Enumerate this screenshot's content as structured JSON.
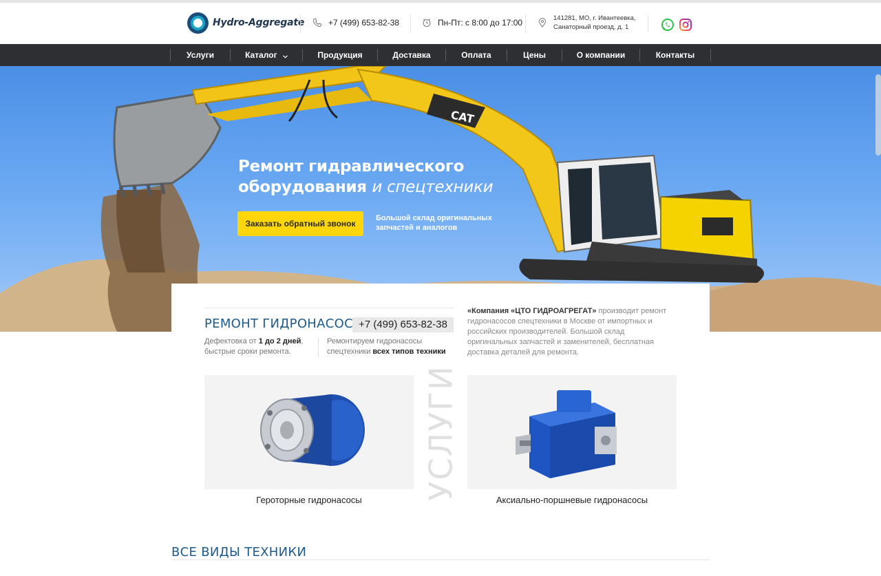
{
  "header": {
    "logo_text": "Hydro-Aggregate",
    "phone": "+7 (499) 653-82-38",
    "hours": "Пн-Пт: с 8:00 до 17:00",
    "address_line1": "141281, МО, г. Ивантеевка,",
    "address_line2": "Санаторный проезд, д. 1"
  },
  "nav": {
    "items": [
      "Услуги",
      "Каталог",
      "Продукция",
      "Доставка",
      "Оплата",
      "Цены",
      "О компании",
      "Контакты"
    ]
  },
  "hero": {
    "title_line1": "Ремонт гидравлического",
    "title_line2_bold": "оборудования",
    "title_line2_italic": "и спецтехники",
    "cta_label": "Заказать обратный звонок",
    "note": "Большой склад оригинальных запчастей и аналогов"
  },
  "repair": {
    "title": "РЕМОНТ ГИДРОНАСОСОВ",
    "phone": "+7 (499) 653-82-38",
    "left_text_1": "Дефектовка от",
    "left_text_bold": "1 до 2 дней",
    "left_text_2": ",",
    "left_text_3": "быстрые сроки ремонта.",
    "right_text_1": "Ремонтируем гидронасосы",
    "right_text_2": "спецтехники",
    "right_text_bold": "всех типов техники",
    "company_bold": "«Компания «ЦТО ГИДРОАГРЕГАТ»",
    "company_text": " производит ремонт гидронасосов спецтехники в Москве от импортных и российских производителей. Большой склад оригинальных запчастей и заменителей, бесплатная доставка деталей для ремонта."
  },
  "services": {
    "vertical_word": "УСЛУГИ",
    "cards": [
      {
        "label": "Героторные гидронасосы"
      },
      {
        "label": "Аксиально-поршневые гидронасосы"
      }
    ]
  },
  "section2": {
    "title": "ВСЕ ВИДЫ ТЕХНИКИ"
  },
  "colors": {
    "accent_blue": "#1d5a8c",
    "nav_bg": "#2d2f33",
    "cta_yellow": "#ffd60a"
  }
}
